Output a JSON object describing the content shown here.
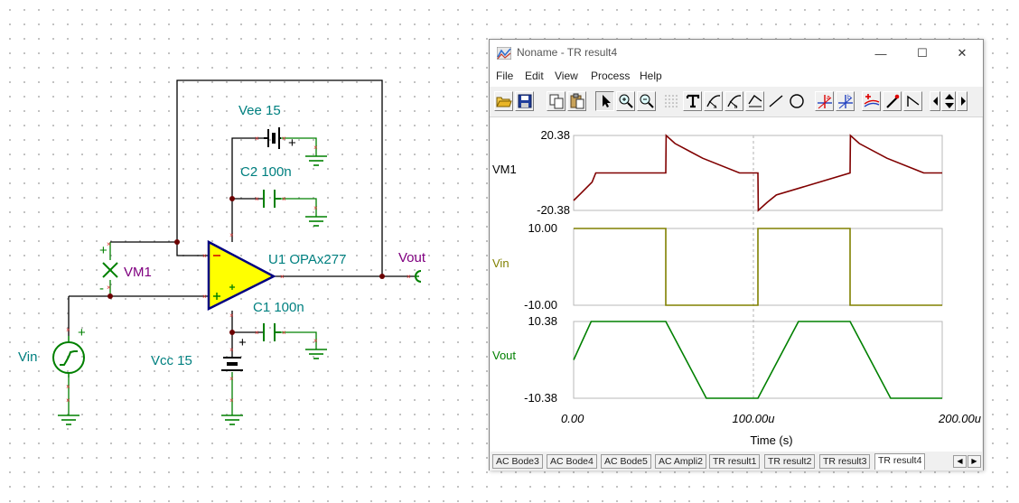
{
  "schematic": {
    "vee_label": "Vee 15",
    "c2_label": "C2 100n",
    "opamp_label": "U1 OPAx277",
    "vout_label": "Vout",
    "vm1_label": "VM1",
    "c1_label": "C1 100n",
    "vin_label": "Vin",
    "vcc_label": "Vcc 15",
    "plus": "+",
    "minus": "-",
    "colors": {
      "wire": "#000000",
      "pin": "#e03030",
      "component": "#008000",
      "label": "#008080",
      "meter": "#800080",
      "opamp_fill": "#ffff00",
      "opamp_border": "#000080"
    }
  },
  "window": {
    "title": "Noname - TR result4",
    "controls": {
      "minimize": "—",
      "maximize": "☐",
      "close": "✕"
    },
    "menu": [
      "File",
      "Edit",
      "View",
      "Process",
      "Help"
    ],
    "toolbar_icons": [
      "open-folder-icon",
      "save-icon",
      "copy-icon",
      "paste-icon",
      "pointer-icon",
      "zoom-in-icon",
      "zoom-out-icon",
      "grid-icon",
      "text-tool-icon",
      "cursor-a-icon",
      "cursor-b-icon",
      "curve-icon",
      "line-tool-icon",
      "circle-tool-icon",
      "cursor-a-marker-icon",
      "cursor-b-marker-icon",
      "add-curve-icon",
      "pen-icon",
      "corner-icon",
      "arrow-left-icon",
      "arrow-updown-icon",
      "arrow-right-icon"
    ],
    "tabs": [
      "AC Bode3",
      "AC Bode4",
      "AC Bode5",
      "AC Ampli2",
      "TR result1",
      "TR result2",
      "TR result3",
      "TR result4"
    ],
    "active_tab": "TR result4",
    "tab_scroll_left": "◀",
    "tab_scroll_right": "▶"
  },
  "chart_data": {
    "type": "line",
    "xlabel": "Time (s)",
    "x_ticks": [
      "0.00",
      "100.00u",
      "200.00u"
    ],
    "xlim": [
      0,
      0.0002
    ],
    "grid": "vertical dashed at x=100u",
    "panels": [
      {
        "name": "VM1",
        "color": "#800000",
        "ylim": [
          -20.38,
          20.38
        ],
        "y_ticks": [
          "20.38",
          "-20.38"
        ],
        "x": [
          0,
          4e-06,
          1e-05,
          1.2e-05,
          5e-05,
          5.02e-05,
          5.5e-05,
          7e-05,
          9e-05,
          0.0001,
          0.0001002,
          0.000105,
          0.00011,
          0.00015,
          0.0001502,
          0.000155,
          0.00017,
          0.00019,
          0.0002
        ],
        "y": [
          -15,
          -11,
          -5,
          0,
          0,
          20.38,
          16,
          8,
          0,
          0,
          -20.38,
          -16,
          -12,
          0,
          20.38,
          16,
          8,
          0,
          0
        ]
      },
      {
        "name": "Vin",
        "color": "#808000",
        "ylim": [
          -10,
          10
        ],
        "y_ticks": [
          "10.00",
          "-10.00"
        ],
        "x": [
          0,
          5e-05,
          5e-05,
          0.0001,
          0.0001,
          0.00015,
          0.00015,
          0.0002
        ],
        "y": [
          10,
          10,
          -10,
          -10,
          10,
          10,
          -10,
          -10
        ]
      },
      {
        "name": "Vout",
        "color": "#008000",
        "ylim": [
          -10.38,
          10.38
        ],
        "y_ticks": [
          "10.38",
          "-10.38"
        ],
        "x": [
          0,
          9.5e-06,
          5e-05,
          7.2e-05,
          0.0001,
          0.000122,
          0.00015,
          0.000172,
          0.0002
        ],
        "y": [
          0,
          10.38,
          10.38,
          -10.38,
          -10.38,
          10.38,
          10.38,
          -10.38,
          -10.38
        ]
      }
    ]
  }
}
